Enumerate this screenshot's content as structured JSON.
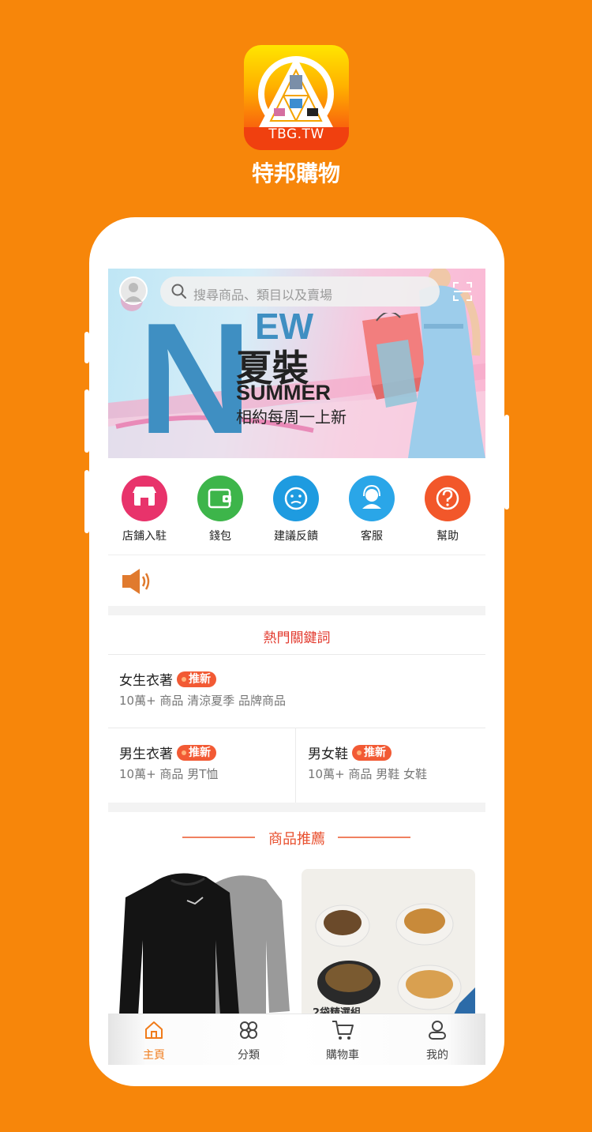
{
  "app": {
    "logo_text": "TBG.TW",
    "name": "特邦購物"
  },
  "banner": {
    "search_placeholder": "搜尋商品、類目以及賣場",
    "headline_letter": "N",
    "headline_rest": "EW",
    "title_cn": "夏裝",
    "title_en": "SUMMER",
    "subtitle": "相約每周一上新"
  },
  "quick_icons": [
    {
      "label": "店鋪入駐",
      "icon": "store-icon",
      "color": "#E8336B"
    },
    {
      "label": "錢包",
      "icon": "wallet-icon",
      "color": "#3DB54A"
    },
    {
      "label": "建議反饋",
      "icon": "feedback-icon",
      "color": "#1E9BE0"
    },
    {
      "label": "客服",
      "icon": "customer-service-icon",
      "color": "#2AA6E8"
    },
    {
      "label": "幫助",
      "icon": "help-icon",
      "color": "#F2572A"
    }
  ],
  "hot_keywords": {
    "title": "熱門關鍵詞",
    "items": [
      {
        "name": "女生衣著",
        "badge": "推新",
        "sub": "10萬+ 商品 清涼夏季 品牌商品"
      },
      {
        "name": "男生衣著",
        "badge": "推新",
        "sub": "10萬+ 商品 男T恤"
      },
      {
        "name": "男女鞋",
        "badge": "推新",
        "sub": "10萬+ 商品 男鞋 女鞋"
      }
    ]
  },
  "recommend": {
    "title": "商品推薦",
    "products": [
      {
        "caption": ""
      },
      {
        "caption": "2袋精選組"
      }
    ]
  },
  "tabbar": [
    {
      "label": "主頁",
      "icon": "home-icon",
      "active": true
    },
    {
      "label": "分類",
      "icon": "category-icon",
      "active": false
    },
    {
      "label": "購物車",
      "icon": "cart-icon",
      "active": false
    },
    {
      "label": "我的",
      "icon": "profile-icon",
      "active": false
    }
  ],
  "colors": {
    "background": "#F7860A",
    "accent": "#F07B1A",
    "hot_title": "#E23A2E",
    "badge": "#F25A34"
  }
}
